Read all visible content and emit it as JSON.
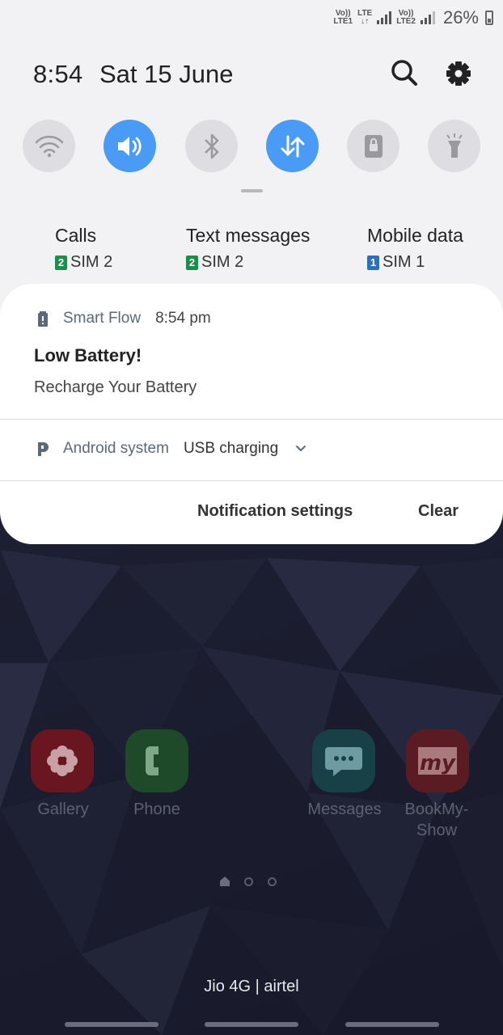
{
  "status": {
    "sim1_volte": "Vo))",
    "sim1_net": "LTE",
    "sim1_label": "LTE1",
    "sim2_volte": "Vo))",
    "sim2_label": "LTE2",
    "battery_percent": "26%"
  },
  "header": {
    "time": "8:54",
    "date": "Sat 15 June"
  },
  "icons": {
    "search": "search-icon",
    "settings": "gear-icon"
  },
  "toggles": [
    {
      "name": "wifi",
      "state": "off"
    },
    {
      "name": "sound",
      "state": "on"
    },
    {
      "name": "bluetooth",
      "state": "off"
    },
    {
      "name": "mobile-data",
      "state": "on"
    },
    {
      "name": "screen-lock",
      "state": "off"
    },
    {
      "name": "flashlight",
      "state": "off"
    }
  ],
  "sim_settings": [
    {
      "title": "Calls",
      "sim": "SIM 2",
      "badge": "2",
      "badge_color": "#1f8b4c"
    },
    {
      "title": "Text messages",
      "sim": "SIM 2",
      "badge": "2",
      "badge_color": "#1f8b4c"
    },
    {
      "title": "Mobile data",
      "sim": "SIM 1",
      "badge": "1",
      "badge_color": "#2f6fb8"
    }
  ],
  "notifications": [
    {
      "app": "Smart Flow",
      "time": "8:54 pm",
      "title": "Low Battery!",
      "body": "Recharge Your Battery"
    },
    {
      "app": "Android system",
      "text": "USB charging"
    }
  ],
  "actions": {
    "settings_label": "Notification settings",
    "clear_label": "Clear"
  },
  "home": {
    "apps": [
      {
        "label": "Gallery"
      },
      {
        "label": "Phone"
      },
      {
        "label": "Messages"
      },
      {
        "label_line1": "BookMy-",
        "label_line2": "Show"
      }
    ],
    "carrier": "Jio 4G | airtel"
  },
  "colors": {
    "accent": "#4a9bf5",
    "panel_bg": "#f2f2f4",
    "card_bg": "#ffffff"
  }
}
